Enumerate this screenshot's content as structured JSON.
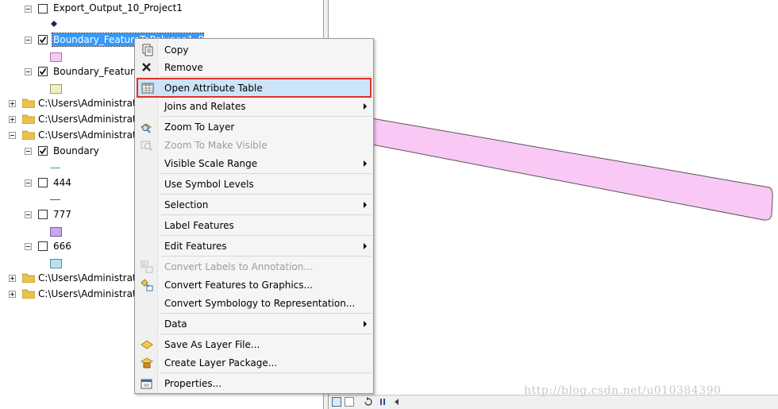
{
  "toc": {
    "rows": [
      {
        "label": "Export_Output_10_Project1"
      },
      {
        "label": "Boundary_FeatureToPolygon1_P"
      },
      {
        "label": "Boundary_Feature"
      },
      {
        "label": "C:\\Users\\Administrat"
      },
      {
        "label": "C:\\Users\\Administrat"
      },
      {
        "label": "C:\\Users\\Administrat"
      },
      {
        "label": "Boundary"
      },
      {
        "label": "444"
      },
      {
        "label": "777"
      },
      {
        "label": "666"
      },
      {
        "label": "C:\\Users\\Administrat"
      },
      {
        "label": "C:\\Users\\Administrat"
      }
    ]
  },
  "context_menu": {
    "items": [
      {
        "label": "Copy"
      },
      {
        "label": "Remove"
      },
      {
        "label": "Open Attribute Table"
      },
      {
        "label": "Joins and Relates"
      },
      {
        "label": "Zoom To Layer"
      },
      {
        "label": "Zoom To Make Visible"
      },
      {
        "label": "Visible Scale Range"
      },
      {
        "label": "Use Symbol Levels"
      },
      {
        "label": "Selection"
      },
      {
        "label": "Label Features"
      },
      {
        "label": "Edit Features"
      },
      {
        "label": "Convert Labels to Annotation..."
      },
      {
        "label": "Convert Features to Graphics..."
      },
      {
        "label": "Convert Symbology to Representation..."
      },
      {
        "label": "Data"
      },
      {
        "label": "Save As Layer File..."
      },
      {
        "label": "Create Layer Package..."
      },
      {
        "label": "Properties..."
      }
    ]
  },
  "watermark": "http://blog.csdn.net/u010384390",
  "colors": {
    "selection": "#3399ff",
    "highlight_border": "#e0302c",
    "highlight_fill": "#cce4f7",
    "polygon_fill": "#f9c8f5",
    "folder": "#e8c24a"
  }
}
